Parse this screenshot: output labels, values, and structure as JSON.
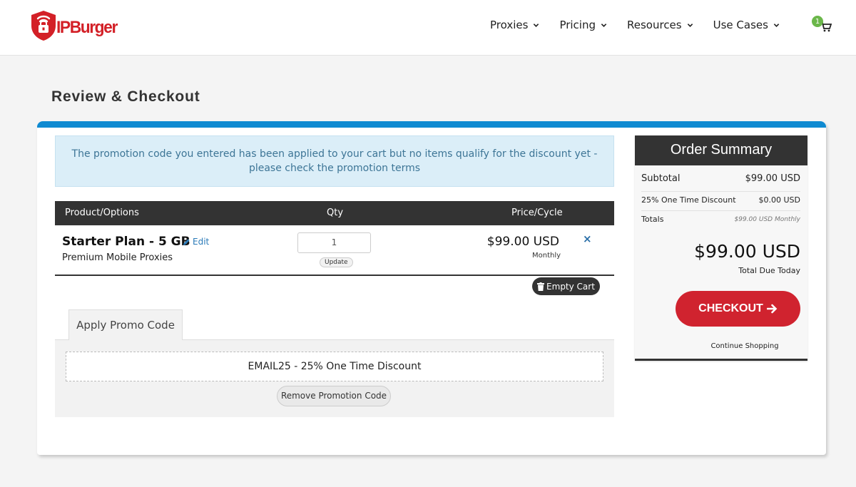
{
  "header": {
    "logo_text": "IPBurger",
    "nav": [
      "Proxies",
      "Pricing",
      "Resources",
      "Use Cases"
    ],
    "cart_count": "1"
  },
  "page": {
    "title": "Review & Checkout"
  },
  "alert": {
    "text": "The promotion code you entered has been applied to your cart but no items qualify for the discount yet - please check the promotion terms"
  },
  "cart_table": {
    "headers": {
      "product": "Product/Options",
      "qty": "Qty",
      "price": "Price/Cycle"
    },
    "items": [
      {
        "name": "Starter Plan - 5 GB",
        "edit_label": "Edit",
        "description": "Premium Mobile Proxies",
        "qty": "1",
        "update_label": "Update",
        "price": "$99.00 USD",
        "cycle": "Monthly",
        "remove_symbol": "×"
      }
    ],
    "empty_cart_label": "Empty Cart"
  },
  "promo": {
    "tab_label": "Apply Promo Code",
    "applied_code": "EMAIL25 - 25% One Time Discount",
    "remove_label": "Remove Promotion Code"
  },
  "summary": {
    "title": "Order Summary",
    "subtotal_label": "Subtotal",
    "subtotal_value": "$99.00 USD",
    "discount_label": "25% One Time Discount",
    "discount_value": "$0.00 USD",
    "totals_label": "Totals",
    "totals_value": "$99.00 USD Monthly",
    "total_amount": "$99.00 USD",
    "total_label": "Total Due Today",
    "checkout_label": "CHECKOUT",
    "continue_label": "Continue Shopping"
  },
  "colors": {
    "brand_red": "#d32027",
    "accent_blue": "#0f8ad1",
    "dark": "#333333",
    "checkout_red": "#d0232f",
    "badge_green": "#6bb74a"
  }
}
